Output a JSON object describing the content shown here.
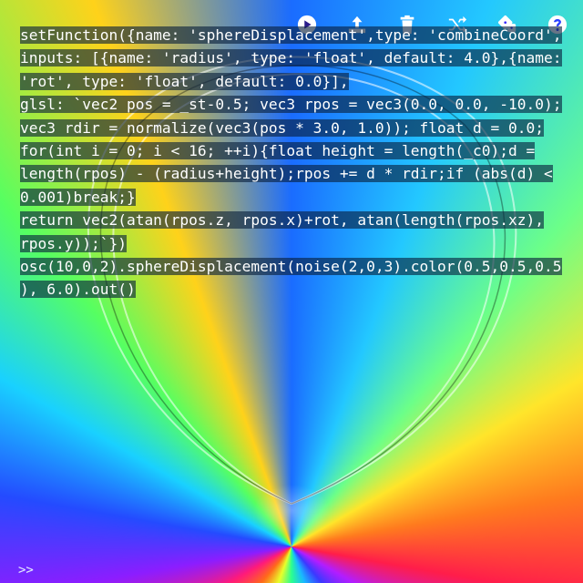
{
  "toolbar": {
    "buttons": [
      {
        "name": "play-icon",
        "label": "run"
      },
      {
        "name": "upload-icon",
        "label": "share"
      },
      {
        "name": "trash-icon",
        "label": "clear"
      },
      {
        "name": "shuffle-icon",
        "label": "random"
      },
      {
        "name": "dice-icon",
        "label": "make random"
      },
      {
        "name": "help-icon",
        "label": "help"
      }
    ]
  },
  "editor": {
    "lines": [
      "setFunction({name: 'sphereDisplacement',type: 'combineCoord',",
      "inputs: [{name: 'radius', type: 'float', default: 4.0},{name:",
      "'rot', type: 'float', default: 0.0}],",
      "glsl: `vec2 pos = _st-0.5; vec3 rpos = vec3(0.0, 0.0, -10.0);",
      "vec3 rdir = normalize(vec3(pos * 3.0, 1.0)); float d = 0.0;",
      "for(int i = 0; i < 16; ++i){float height = length(_c0);d =",
      "length(rpos) - (radius+height);rpos += d * rdir;if (abs(d) <",
      "0.001)break;}",
      "return vec2(atan(rpos.z, rpos.x)+rot, atan(length(rpos.xz),",
      "rpos.y));`})",
      "",
      "osc(10,0,2).sphereDisplacement(noise(2,0,3).color(0.5,0.5,0.5",
      "), 6.0).out()"
    ]
  },
  "console": {
    "prompt": ">>"
  }
}
